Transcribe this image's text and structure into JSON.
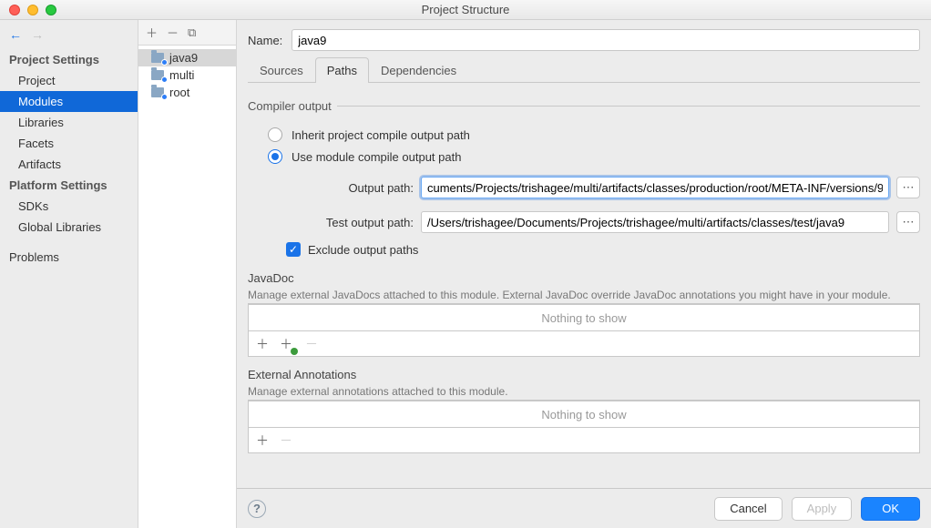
{
  "window": {
    "title": "Project Structure"
  },
  "sidebar": {
    "sections": [
      {
        "title": "Project Settings",
        "items": [
          "Project",
          "Modules",
          "Libraries",
          "Facets",
          "Artifacts"
        ],
        "selected": "Modules"
      },
      {
        "title": "Platform Settings",
        "items": [
          "SDKs",
          "Global Libraries"
        ]
      },
      {
        "title": "",
        "items": [
          "Problems"
        ]
      }
    ]
  },
  "tree": {
    "items": [
      "java9",
      "multi",
      "root"
    ],
    "selected": "java9"
  },
  "module": {
    "name_label": "Name:",
    "name": "java9",
    "tabs": [
      "Sources",
      "Paths",
      "Dependencies"
    ],
    "active_tab": "Paths",
    "paths": {
      "group_title": "Compiler output",
      "inherit_label": "Inherit project compile output path",
      "use_module_label": "Use module compile output path",
      "selected_radio": "use_module",
      "output_label": "Output path:",
      "output_value": "cuments/Projects/trishagee/multi/artifacts/classes/production/root/META-INF/versions/9",
      "test_output_label": "Test output path:",
      "test_output_value": "/Users/trishagee/Documents/Projects/trishagee/multi/artifacts/classes/test/java9",
      "exclude_label": "Exclude output paths",
      "exclude_checked": true
    },
    "javadoc": {
      "title": "JavaDoc",
      "subtitle": "Manage external JavaDocs attached to this module. External JavaDoc override JavaDoc annotations you might have in your module.",
      "empty": "Nothing to show"
    },
    "annotations": {
      "title": "External Annotations",
      "subtitle": "Manage external annotations attached to this module.",
      "empty": "Nothing to show"
    }
  },
  "footer": {
    "cancel": "Cancel",
    "apply": "Apply",
    "ok": "OK"
  }
}
